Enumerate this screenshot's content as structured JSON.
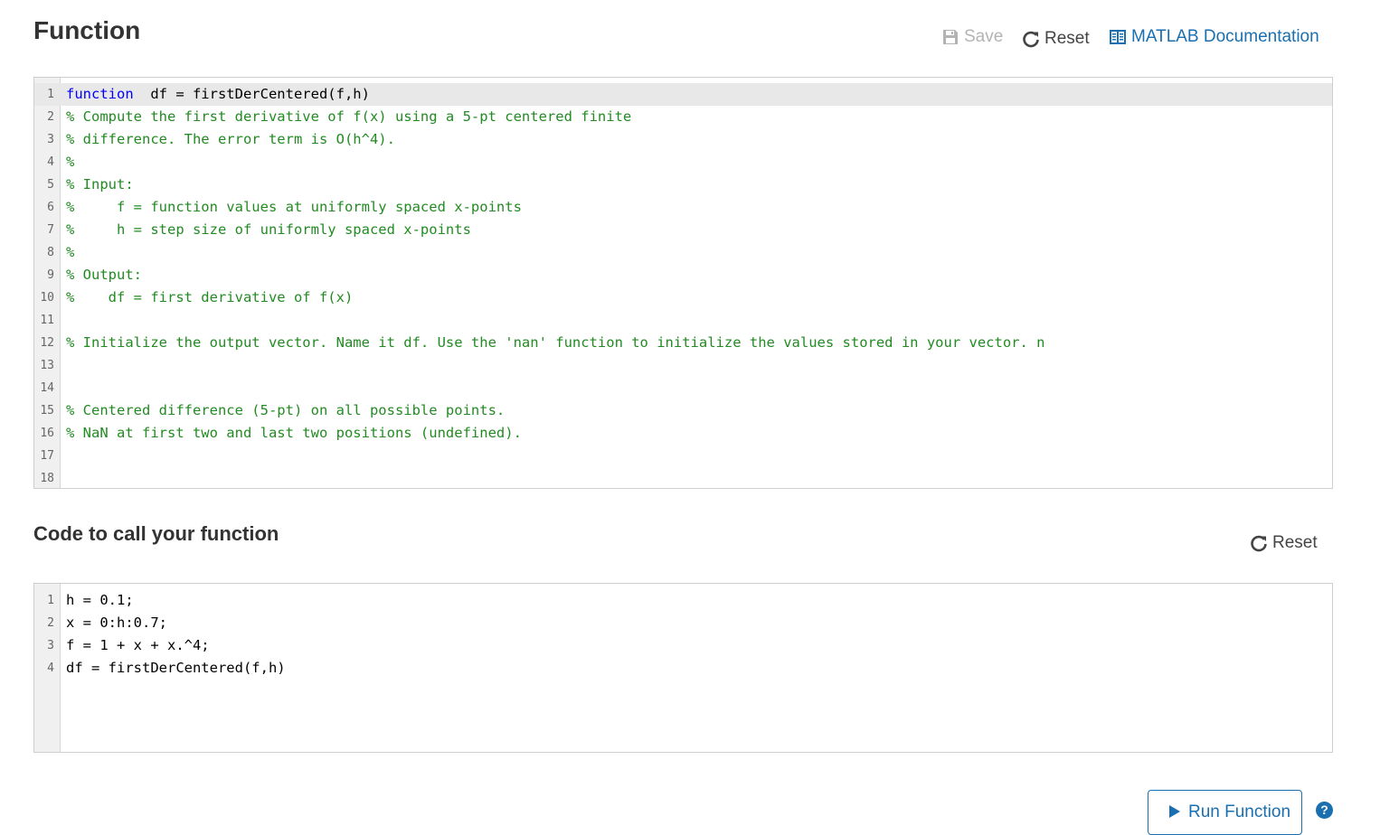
{
  "function_section": {
    "title": "Function",
    "save_label": "Save",
    "reset_label": "Reset",
    "doc_label": "MATLAB Documentation",
    "lines": [
      {
        "n": "1",
        "kw": "function",
        "text": "  df = firstDerCentered(f,h)"
      },
      {
        "n": "2",
        "text": "% Compute the first derivative of f(x) using a 5-pt centered finite"
      },
      {
        "n": "3",
        "text": "% difference. The error term is O(h^4)."
      },
      {
        "n": "4",
        "text": "%"
      },
      {
        "n": "5",
        "text": "% Input:"
      },
      {
        "n": "6",
        "text": "%     f = function values at uniformly spaced x-points"
      },
      {
        "n": "7",
        "text": "%     h = step size of uniformly spaced x-points"
      },
      {
        "n": "8",
        "text": "%"
      },
      {
        "n": "9",
        "text": "% Output:"
      },
      {
        "n": "10",
        "text": "%    df = first derivative of f(x)"
      },
      {
        "n": "11",
        "text": ""
      },
      {
        "n": "12",
        "text": "% Initialize the output vector. Name it df. Use the 'nan' function to initialize the values stored in your vector. n"
      },
      {
        "n": "13",
        "text": ""
      },
      {
        "n": "14",
        "text": ""
      },
      {
        "n": "15",
        "text": "% Centered difference (5-pt) on all possible points."
      },
      {
        "n": "16",
        "text": "% NaN at first two and last two positions (undefined)."
      },
      {
        "n": "17",
        "text": ""
      },
      {
        "n": "18",
        "text": ""
      }
    ]
  },
  "call_section": {
    "title": "Code to call your function",
    "reset_label": "Reset",
    "lines": [
      {
        "n": "1",
        "text": "h = 0.1;"
      },
      {
        "n": "2",
        "text": "x = 0:h:0.7;"
      },
      {
        "n": "3",
        "text": "f = 1 + x + x.^4;"
      },
      {
        "n": "4",
        "text": "df = firstDerCentered(f,h)"
      }
    ]
  },
  "run_label": "Run Function",
  "help_glyph": "?",
  "colors": {
    "link": "#1a6fb0",
    "comment": "#228b22",
    "keyword": "#0000ff",
    "disabled": "#b3b3b3"
  },
  "icons": {
    "save": "floppy-disk-icon",
    "reset": "refresh-icon",
    "doc": "book-icon",
    "run": "play-icon",
    "help": "question-circle-icon"
  }
}
